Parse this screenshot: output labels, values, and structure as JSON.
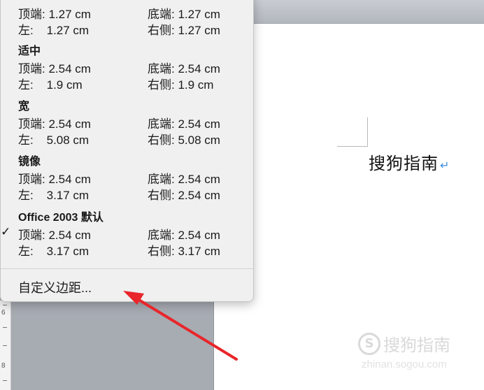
{
  "document": {
    "text": "搜狗指南",
    "return_mark": "↵"
  },
  "ruler": {
    "numbers": [
      "6",
      "8"
    ]
  },
  "watermark": {
    "logo": "S",
    "name": "搜狗指南",
    "url": "zhinan.sogou.com"
  },
  "menu": {
    "top_preset": {
      "row1_left": "顶端: 1.27 cm",
      "row1_right": "底端: 1.27 cm",
      "row2_left": "左:    1.27 cm",
      "row2_right": "右侧: 1.27 cm"
    },
    "presets": [
      {
        "title": "适中",
        "row1_left": "顶端: 2.54 cm",
        "row1_right": "底端: 2.54 cm",
        "row2_left": "左:    1.9 cm",
        "row2_right": "右侧: 1.9 cm"
      },
      {
        "title": "宽",
        "row1_left": "顶端: 2.54 cm",
        "row1_right": "底端: 2.54 cm",
        "row2_left": "左:    5.08 cm",
        "row2_right": "右侧: 5.08 cm"
      },
      {
        "title": "镜像",
        "row1_left": "顶端: 2.54 cm",
        "row1_right": "底端: 2.54 cm",
        "row2_left": "左:    3.17 cm",
        "row2_right": "右侧: 2.54 cm"
      },
      {
        "title": "Office 2003 默认",
        "checkmark": "✓",
        "row1_left": "顶端: 2.54 cm",
        "row1_right": "底端: 2.54 cm",
        "row2_left": "左:    3.17 cm",
        "row2_right": "右侧: 3.17 cm"
      }
    ],
    "custom_label": "自定义边距..."
  },
  "colors": {
    "arrow": "#e8262b",
    "paragraph_mark": "#3b8ee0"
  }
}
